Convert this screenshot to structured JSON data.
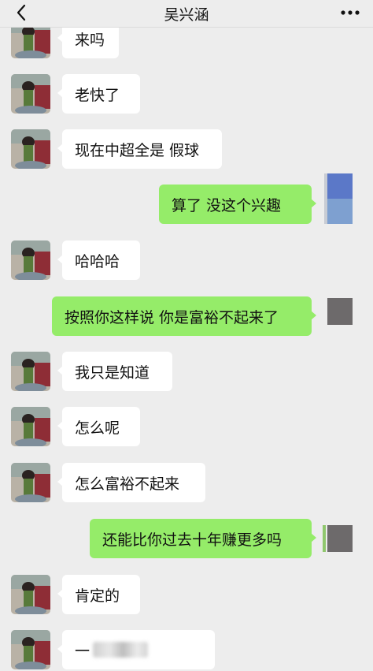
{
  "header": {
    "title": "吴兴涵",
    "back_icon": "chevron-left-icon",
    "more_icon": "more-dots-icon"
  },
  "colors": {
    "background": "#ededed",
    "incoming_bubble": "#ffffff",
    "outgoing_bubble": "#95ec69",
    "self_avatar_square": "#6d6a6b",
    "self_avatar_blue_top": "#5b78c8",
    "self_avatar_blue_bottom": "#7ea0d0"
  },
  "messages": [
    {
      "side": "left",
      "text": "来吗"
    },
    {
      "side": "left",
      "text": "老快了"
    },
    {
      "side": "left",
      "text": "现在中超全是 假球"
    },
    {
      "side": "right",
      "text": "算了 没这个兴趣"
    },
    {
      "side": "left",
      "text": "哈哈哈"
    },
    {
      "side": "right",
      "text": "按照你这样说 你是富裕不起来了"
    },
    {
      "side": "left",
      "text": "我只是知道"
    },
    {
      "side": "left",
      "text": "怎么呢"
    },
    {
      "side": "left",
      "text": "怎么富裕不起来"
    },
    {
      "side": "right",
      "text": "还能比你过去十年赚更多吗"
    },
    {
      "side": "left",
      "text": "肯定的"
    },
    {
      "side": "left",
      "text": "一"
    }
  ]
}
